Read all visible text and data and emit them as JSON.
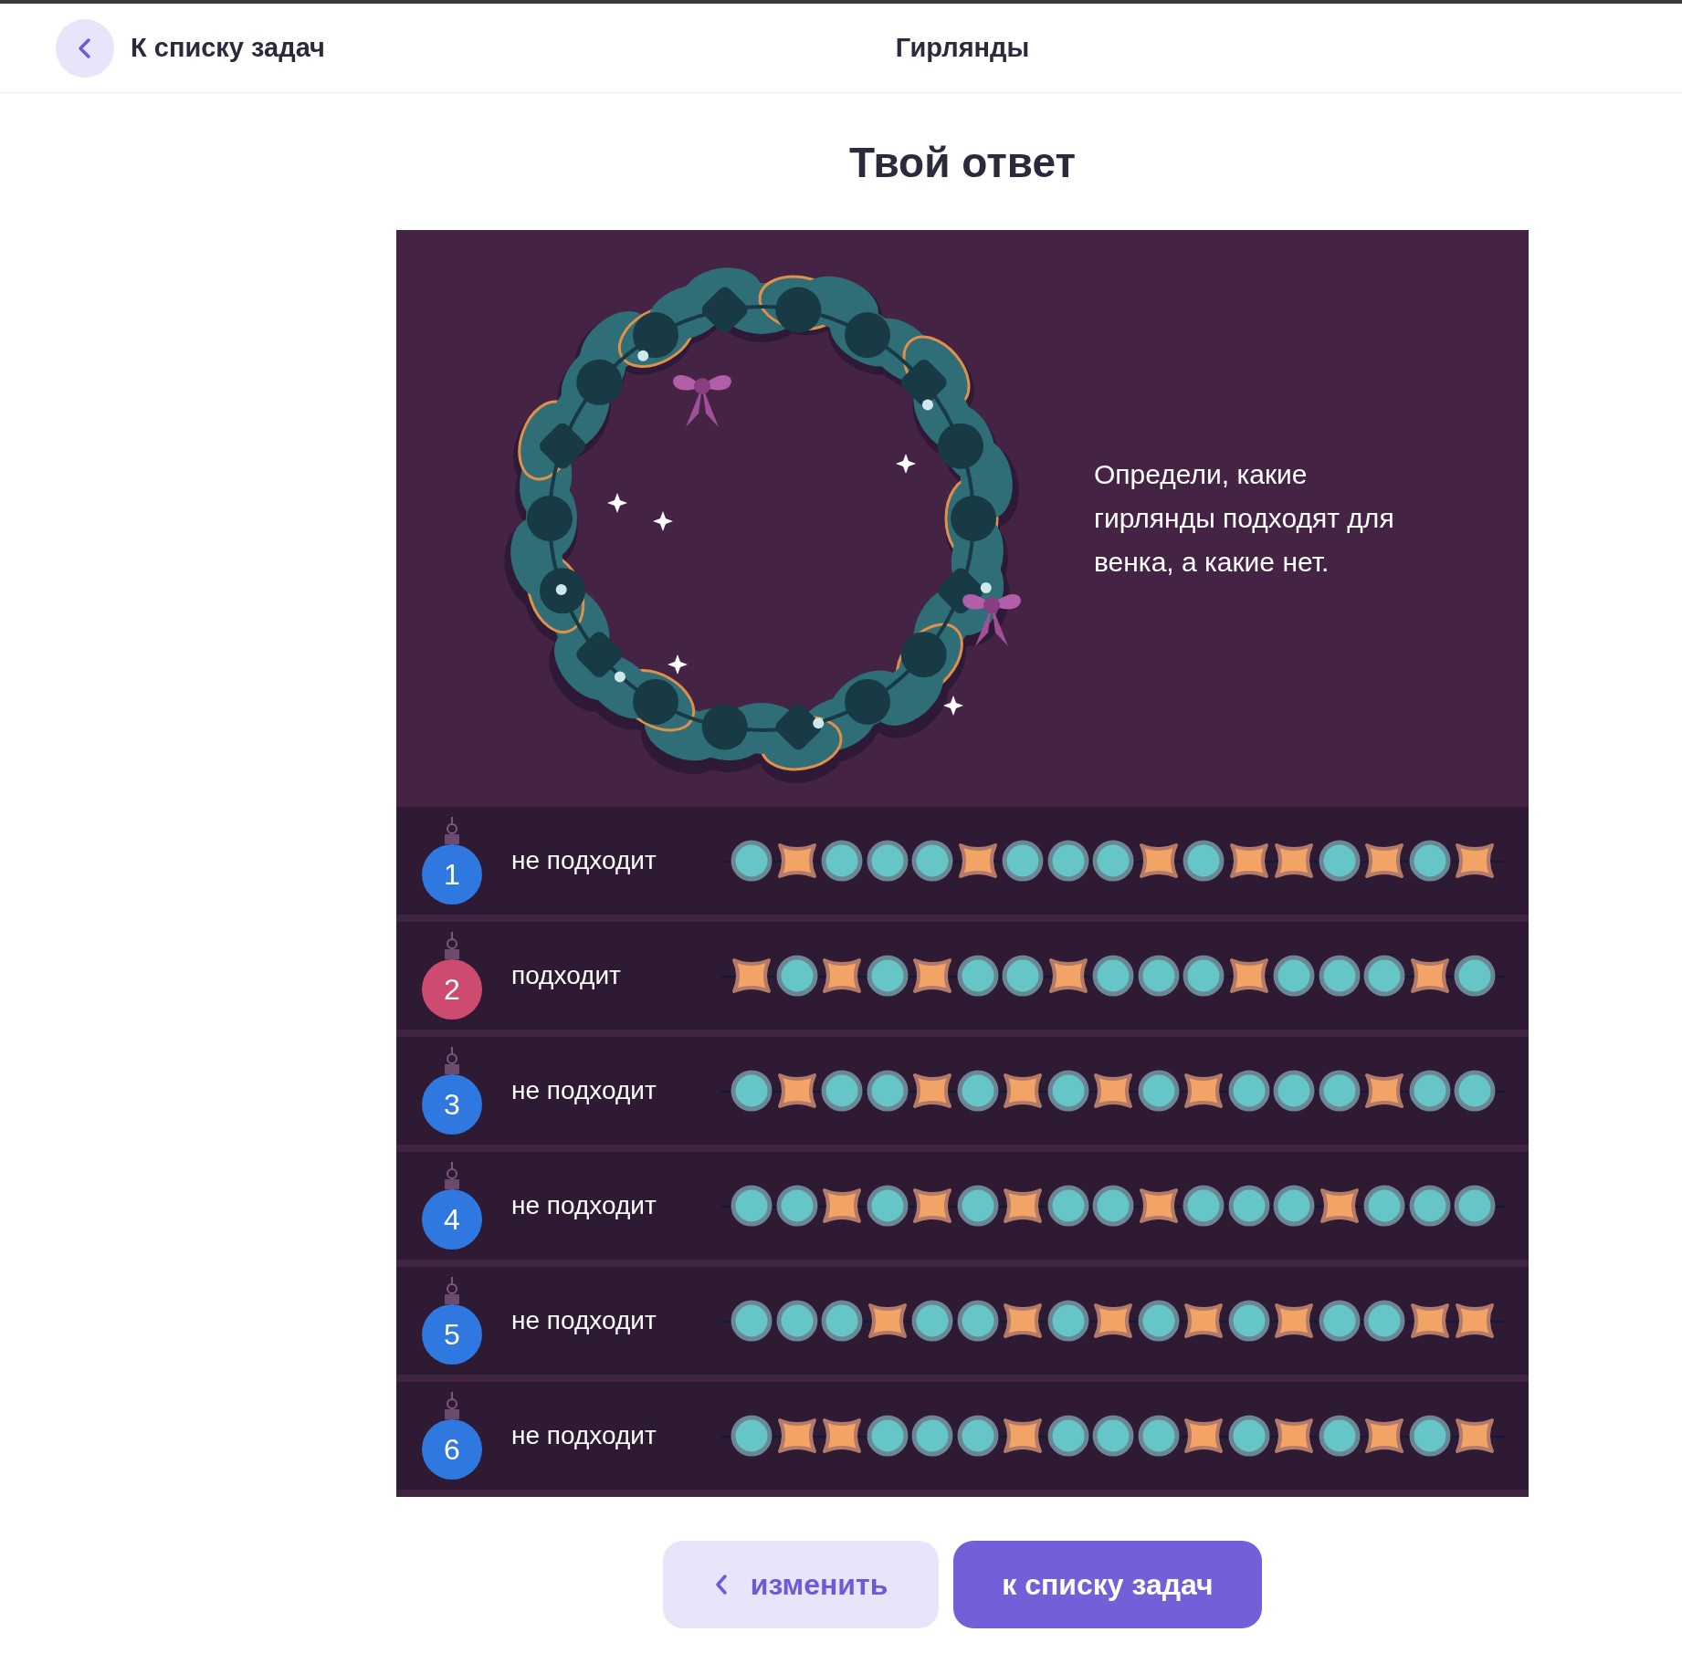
{
  "header": {
    "back_link": "К списку задач",
    "title": "Гирлянды"
  },
  "heading": "Твой ответ",
  "task": {
    "prompt": "Определи, какие гирлянды подходят для венка, а какие нет."
  },
  "garlands": [
    {
      "number": "1",
      "verdict": "не подходит",
      "fits": false,
      "beads": [
        {
          "kind": "circle"
        },
        {
          "kind": "star"
        },
        {
          "kind": "circle"
        },
        {
          "kind": "circle"
        },
        {
          "kind": "circle"
        },
        {
          "kind": "star"
        },
        {
          "kind": "circle"
        },
        {
          "kind": "circle"
        },
        {
          "kind": "circle"
        },
        {
          "kind": "star"
        },
        {
          "kind": "circle"
        },
        {
          "kind": "star"
        },
        {
          "kind": "star"
        },
        {
          "kind": "circle"
        },
        {
          "kind": "star"
        },
        {
          "kind": "circle"
        },
        {
          "kind": "star"
        }
      ]
    },
    {
      "number": "2",
      "verdict": "подходит",
      "fits": true,
      "beads": [
        {
          "kind": "star"
        },
        {
          "kind": "circle"
        },
        {
          "kind": "star"
        },
        {
          "kind": "circle"
        },
        {
          "kind": "star"
        },
        {
          "kind": "circle"
        },
        {
          "kind": "circle"
        },
        {
          "kind": "star"
        },
        {
          "kind": "circle"
        },
        {
          "kind": "circle"
        },
        {
          "kind": "circle"
        },
        {
          "kind": "star"
        },
        {
          "kind": "circle"
        },
        {
          "kind": "circle"
        },
        {
          "kind": "circle"
        },
        {
          "kind": "star"
        },
        {
          "kind": "circle"
        }
      ]
    },
    {
      "number": "3",
      "verdict": "не подходит",
      "fits": false,
      "beads": [
        {
          "kind": "circle"
        },
        {
          "kind": "star"
        },
        {
          "kind": "circle"
        },
        {
          "kind": "circle"
        },
        {
          "kind": "star"
        },
        {
          "kind": "circle"
        },
        {
          "kind": "star"
        },
        {
          "kind": "circle"
        },
        {
          "kind": "star"
        },
        {
          "kind": "circle"
        },
        {
          "kind": "star"
        },
        {
          "kind": "circle"
        },
        {
          "kind": "circle"
        },
        {
          "kind": "circle"
        },
        {
          "kind": "star"
        },
        {
          "kind": "circle"
        },
        {
          "kind": "circle"
        }
      ]
    },
    {
      "number": "4",
      "verdict": "не подходит",
      "fits": false,
      "beads": [
        {
          "kind": "circle"
        },
        {
          "kind": "circle"
        },
        {
          "kind": "star"
        },
        {
          "kind": "circle"
        },
        {
          "kind": "star"
        },
        {
          "kind": "circle"
        },
        {
          "kind": "star"
        },
        {
          "kind": "circle"
        },
        {
          "kind": "circle"
        },
        {
          "kind": "star"
        },
        {
          "kind": "circle"
        },
        {
          "kind": "circle"
        },
        {
          "kind": "circle"
        },
        {
          "kind": "star"
        },
        {
          "kind": "circle"
        },
        {
          "kind": "circle"
        },
        {
          "kind": "circle"
        }
      ]
    },
    {
      "number": "5",
      "verdict": "не подходит",
      "fits": false,
      "beads": [
        {
          "kind": "circle"
        },
        {
          "kind": "circle"
        },
        {
          "kind": "circle"
        },
        {
          "kind": "star"
        },
        {
          "kind": "circle"
        },
        {
          "kind": "circle"
        },
        {
          "kind": "star"
        },
        {
          "kind": "circle"
        },
        {
          "kind": "star"
        },
        {
          "kind": "circle"
        },
        {
          "kind": "star"
        },
        {
          "kind": "circle"
        },
        {
          "kind": "star"
        },
        {
          "kind": "circle"
        },
        {
          "kind": "circle"
        },
        {
          "kind": "star"
        },
        {
          "kind": "star"
        }
      ]
    },
    {
      "number": "6",
      "verdict": "не подходит",
      "fits": false,
      "beads": [
        {
          "kind": "circle"
        },
        {
          "kind": "star"
        },
        {
          "kind": "star"
        },
        {
          "kind": "circle"
        },
        {
          "kind": "circle"
        },
        {
          "kind": "circle"
        },
        {
          "kind": "star"
        },
        {
          "kind": "circle"
        },
        {
          "kind": "circle"
        },
        {
          "kind": "circle"
        },
        {
          "kind": "star"
        },
        {
          "kind": "circle"
        },
        {
          "kind": "star"
        },
        {
          "kind": "circle"
        },
        {
          "kind": "star"
        },
        {
          "kind": "circle"
        },
        {
          "kind": "star"
        }
      ]
    }
  ],
  "buttons": {
    "edit": "изменить",
    "to_list": "к списку задач"
  }
}
